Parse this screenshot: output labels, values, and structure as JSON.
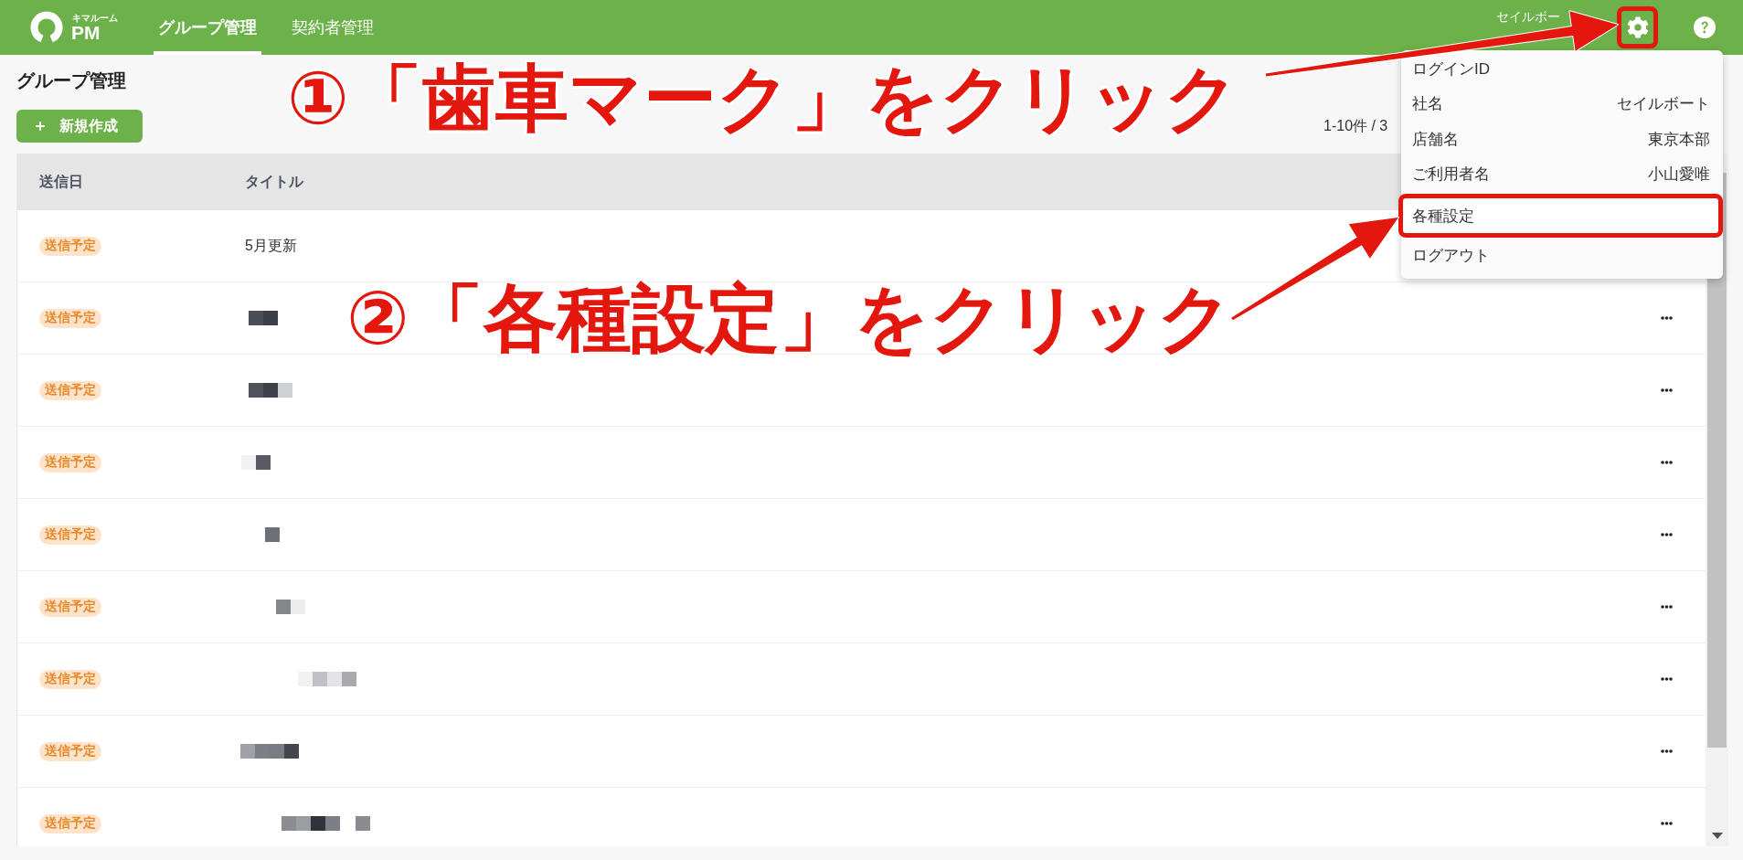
{
  "header": {
    "logo": {
      "small_text": "キマルーム",
      "text": "PM"
    },
    "tabs": [
      {
        "label": "グループ管理",
        "selected": true
      },
      {
        "label": "契約者管理",
        "selected": false
      }
    ],
    "user_name": "セイルボー",
    "settings_button": {
      "highlighted": true
    }
  },
  "page": {
    "title": "グループ管理",
    "new_button": "新規作成",
    "pagination": "1-10件 / 3"
  },
  "table": {
    "columns": [
      "送信日",
      "タイトル"
    ],
    "rows": [
      {
        "status": "送信予定",
        "kind": "text",
        "title": "5月更新",
        "menu_button": false
      },
      {
        "status": "送信予定",
        "kind": "redacted",
        "menu_button": true
      },
      {
        "status": "送信予定",
        "kind": "redacted",
        "menu_button": true
      },
      {
        "status": "送信予定",
        "kind": "redacted",
        "menu_button": true
      },
      {
        "status": "送信予定",
        "kind": "redacted",
        "menu_button": true
      },
      {
        "status": "送信予定",
        "kind": "redacted",
        "menu_button": true
      },
      {
        "status": "送信予定",
        "kind": "redacted",
        "menu_button": true
      },
      {
        "status": "送信予定",
        "kind": "redacted",
        "menu_button": true
      },
      {
        "status": "送信予定",
        "kind": "redacted",
        "menu_button": true
      }
    ]
  },
  "user_menu": {
    "items": [
      {
        "kind": "info",
        "label": "ログインID"
      },
      {
        "kind": "info",
        "label": "社名",
        "value": "セイルボート"
      },
      {
        "kind": "info",
        "label": "店舗名",
        "value": "東京本部"
      },
      {
        "kind": "info",
        "label": "ご利用者名",
        "value": "小山愛唯"
      },
      {
        "kind": "action",
        "label": "各種設定",
        "highlighted": true
      },
      {
        "kind": "action",
        "label": "ログアウト",
        "highlighted": false
      }
    ]
  },
  "callouts": [
    {
      "text": "①「歯車マーク」をクリック"
    },
    {
      "text": "②「各種設定」をクリック"
    }
  ]
}
